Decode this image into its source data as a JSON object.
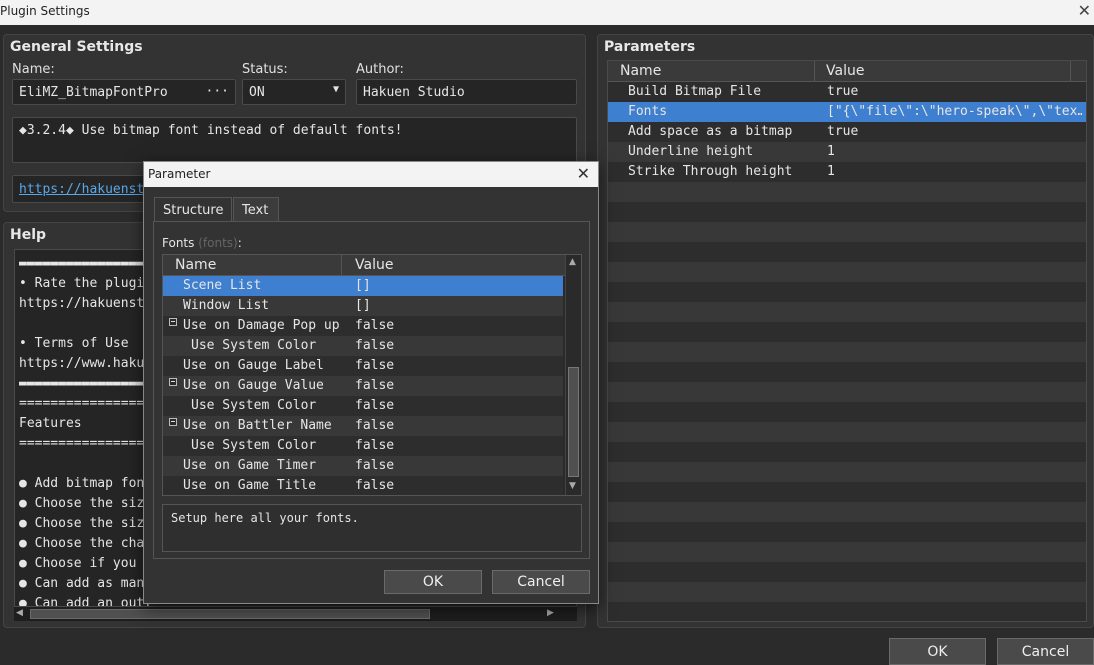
{
  "window": {
    "title": "Plugin Settings",
    "close": "✕"
  },
  "general": {
    "title": "General Settings",
    "name_label": "Name:",
    "name_value": "EliMZ_BitmapFontPro",
    "name_more": "···",
    "status_label": "Status:",
    "status_value": "ON",
    "author_label": "Author:",
    "author_value": "Hakuen Studio",
    "description": "◆3.2.4◆ Use bitmap font instead of default fonts!",
    "link": "https://hakuenstudio.itch.io"
  },
  "help": {
    "title": "Help",
    "lines": [
      "▬▬▬▬▬▬▬▬▬▬▬▬▬▬▬▬▬",
      "• Rate the plugin!",
      "https://hakuenstudio",
      "",
      "• Terms of Use",
      "https://www.hakuen",
      "▬▬▬▬▬▬▬▬▬▬▬▬▬▬▬▬▬",
      "===================",
      "Features",
      "===================",
      "",
      "● Add bitmap font",
      "● Choose the size",
      "● Choose the size",
      "● Choose the char",
      "● Choose if you w",
      "● Can add as many",
      "● Can add an outl"
    ]
  },
  "parameters": {
    "title": "Parameters",
    "col_name": "Name",
    "col_value": "Value",
    "rows": [
      {
        "name": "Build Bitmap File",
        "value": "true"
      },
      {
        "name": "Fonts",
        "value": "[\"{\\\"file\\\":\\\"hero-speak\\\",\\\"tex…"
      },
      {
        "name": "Add space as a bitmap",
        "value": "true"
      },
      {
        "name": "Underline height",
        "value": "1"
      },
      {
        "name": "Strike Through height",
        "value": "1"
      }
    ],
    "selected_index": 1
  },
  "footer": {
    "ok": "OK",
    "cancel": "Cancel"
  },
  "dialog": {
    "title": "Parameter",
    "close": "✕",
    "tabs": [
      "Structure",
      "Text"
    ],
    "field_label": "Fonts",
    "field_key": "(fonts)",
    "field_colon": ":",
    "col_name": "Name",
    "col_value": "Value",
    "rows": [
      {
        "name": "Scene List",
        "value": "[]",
        "indent": 1,
        "toggle": false
      },
      {
        "name": "Window List",
        "value": "[]",
        "indent": 1,
        "toggle": false
      },
      {
        "name": "Use on Damage Pop up",
        "value": "false",
        "indent": 1,
        "toggle": true
      },
      {
        "name": "Use System Color",
        "value": "false",
        "indent": 2,
        "toggle": false
      },
      {
        "name": "Use on Gauge Label",
        "value": "false",
        "indent": 1,
        "toggle": false
      },
      {
        "name": "Use on Gauge Value",
        "value": "false",
        "indent": 1,
        "toggle": true
      },
      {
        "name": "Use System Color",
        "value": "false",
        "indent": 2,
        "toggle": false
      },
      {
        "name": "Use on Battler Name",
        "value": "false",
        "indent": 1,
        "toggle": true
      },
      {
        "name": "Use System Color",
        "value": "false",
        "indent": 2,
        "toggle": false
      },
      {
        "name": "Use on Game Timer",
        "value": "false",
        "indent": 1,
        "toggle": false
      },
      {
        "name": "Use on Game Title",
        "value": "false",
        "indent": 1,
        "toggle": false
      }
    ],
    "selected_index": 0,
    "description": "Setup here all your fonts.",
    "ok": "OK",
    "cancel": "Cancel"
  },
  "colors": {
    "selection": "#3e7fcf",
    "link": "#5aa7e8",
    "panel": "#333333"
  }
}
